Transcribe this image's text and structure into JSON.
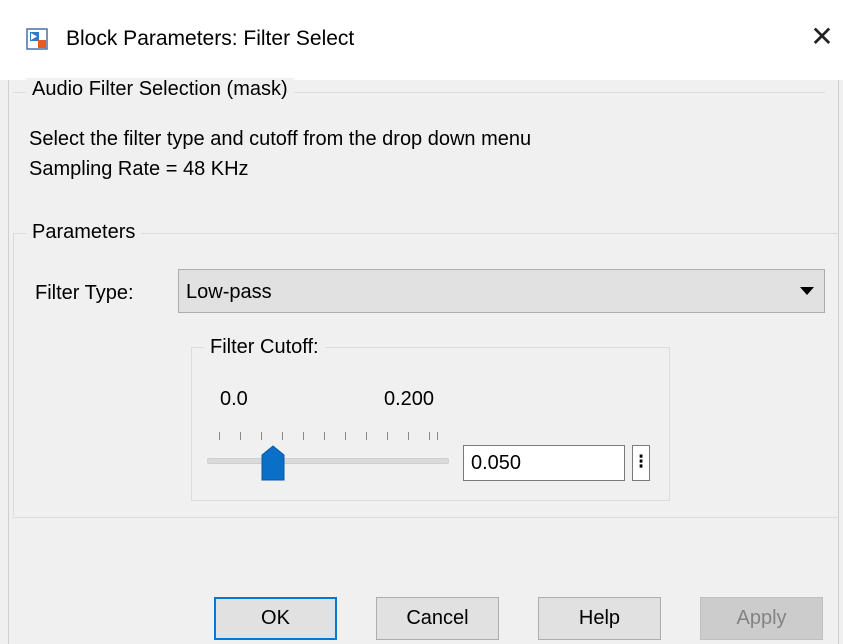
{
  "window": {
    "title": "Block Parameters: Filter Select",
    "close_glyph": "✕"
  },
  "mask_group": {
    "legend": "Audio Filter Selection (mask)",
    "description_lines": [
      "Select the filter type and cutoff from the drop down menu",
      "Sampling Rate = 48 KHz"
    ]
  },
  "parameters_group": {
    "legend": "Parameters",
    "filter_type": {
      "label": "Filter Type:",
      "selected": "Low-pass"
    },
    "filter_cutoff": {
      "legend": "Filter Cutoff:",
      "min_label": "0.0",
      "max_label": "0.200",
      "value": "0.050",
      "slider_fraction": 0.25,
      "more_glyph": "⁝"
    }
  },
  "buttons": {
    "ok": "OK",
    "cancel": "Cancel",
    "help": "Help",
    "apply": "Apply"
  },
  "colors": {
    "accent": "#0078d7",
    "thumb": "#0a6fc7"
  },
  "icons": {
    "app": "simulink-block-icon",
    "close": "close-icon",
    "dropdown": "chevron-down-icon",
    "more": "more-options-icon"
  }
}
